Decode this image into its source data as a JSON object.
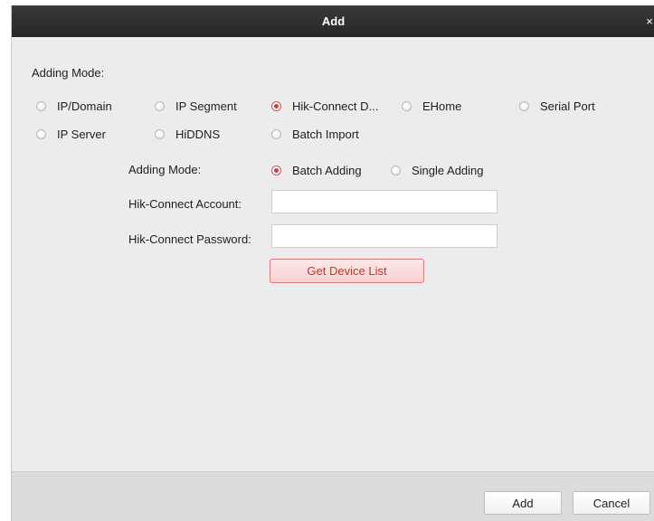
{
  "dialog": {
    "title": "Add",
    "close_glyph": "×"
  },
  "adding_mode": {
    "label": "Adding Mode:",
    "options": [
      {
        "label": "IP/Domain",
        "checked": false
      },
      {
        "label": "IP Segment",
        "checked": false
      },
      {
        "label": "Hik-Connect D...",
        "checked": true
      },
      {
        "label": "EHome",
        "checked": false
      },
      {
        "label": "Serial Port",
        "checked": false
      },
      {
        "label": "IP Server",
        "checked": false
      },
      {
        "label": "HiDDNS",
        "checked": false
      },
      {
        "label": "Batch Import",
        "checked": false
      }
    ]
  },
  "sub_mode": {
    "label": "Adding Mode:",
    "options": [
      {
        "label": "Batch Adding",
        "checked": true
      },
      {
        "label": "Single Adding",
        "checked": false
      }
    ]
  },
  "form": {
    "account_label": "Hik-Connect Account:",
    "account_value": "",
    "password_label": "Hik-Connect Password:",
    "password_value": "",
    "get_device_list_label": "Get Device List"
  },
  "footer": {
    "add_label": "Add",
    "cancel_label": "Cancel"
  },
  "colors": {
    "accent": "#d63a3a",
    "titlebar": "#2e2e2e"
  }
}
